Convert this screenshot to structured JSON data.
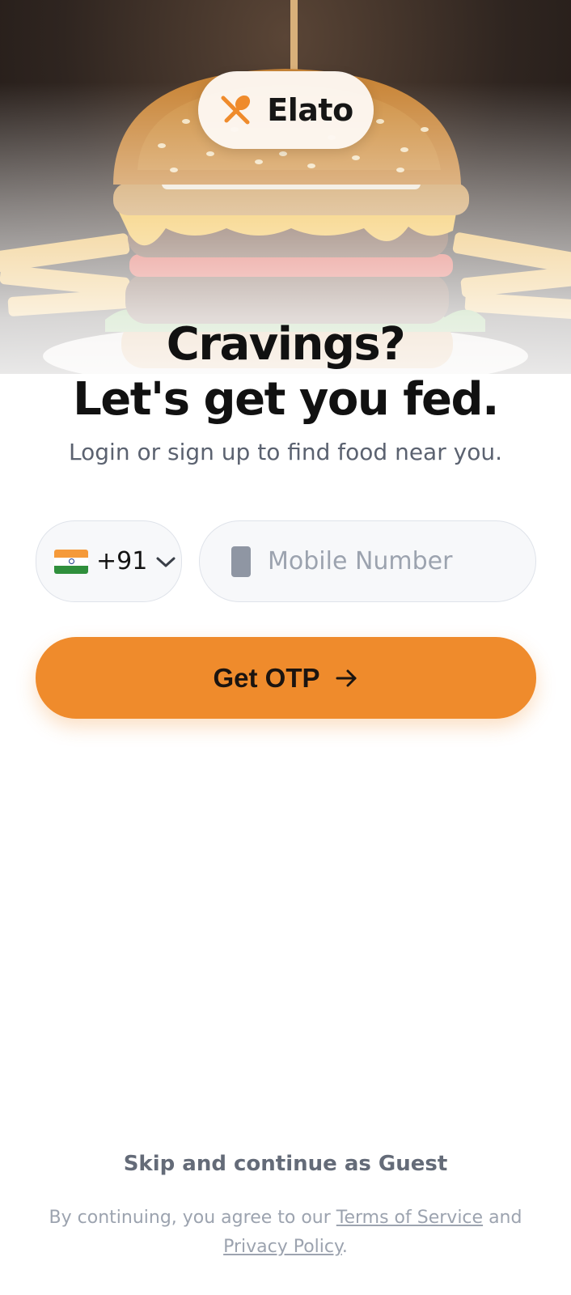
{
  "brand": {
    "name": "Elato",
    "logo_icon": "fork-spoon-icon",
    "accent_color": "#ef8b2c"
  },
  "hero": {
    "image": "burger-photo"
  },
  "headline": {
    "line1": "Cravings?",
    "line2": "Let's get you fed."
  },
  "subtitle": "Login or sign up to find food near you.",
  "country_selector": {
    "flag": "india-flag",
    "code": "+91",
    "chevron": "chevron-down-icon"
  },
  "phone_field": {
    "icon": "phone-icon",
    "placeholder": "Mobile Number",
    "value": ""
  },
  "cta": {
    "label": "Get OTP",
    "icon": "arrow-right-icon"
  },
  "guest_link": "Skip and continue as Guest",
  "legal": {
    "prefix": "By continuing, you agree to our ",
    "terms": "Terms of Service",
    "middle": " and ",
    "privacy": "Privacy Policy",
    "suffix": "."
  }
}
